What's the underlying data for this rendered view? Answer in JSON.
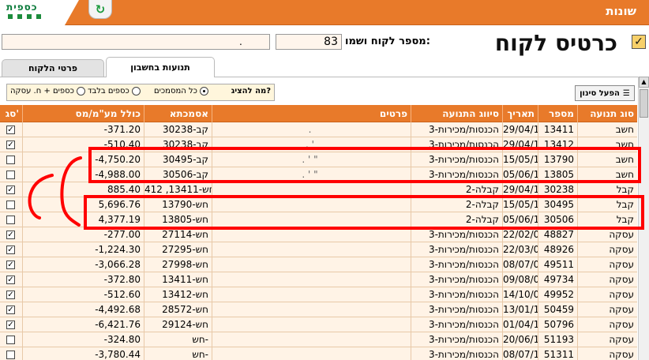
{
  "app": {
    "logo_text": "כספית",
    "title": "שונות"
  },
  "header": {
    "page_title": "כרטיס לקוח",
    "customer_label": "מספר לקוח ושמו:",
    "customer_number": "83",
    "customer_name": "."
  },
  "tabs": [
    {
      "label": "תנועות בחשבון",
      "active": true
    },
    {
      "label": "פרטי הלקוח",
      "active": false
    }
  ],
  "filter": {
    "question": "מה להציג?",
    "options": [
      {
        "label": "כל המסמכים",
        "selected": true
      },
      {
        "label": "כספים בלבד",
        "selected": false
      },
      {
        "label": "כספים + ח. עסקה",
        "selected": false
      }
    ],
    "button_label": "הפעל סינון"
  },
  "table": {
    "columns": [
      "סוג תנועה",
      "מספר",
      "תאריך",
      "סיווג התנועה",
      "פרטים",
      "אסמכתא",
      "כולל מע\"מ/מס",
      "סג'"
    ],
    "rows": [
      {
        "type": "חשב",
        "number": "13411",
        "date": "29/04/10",
        "category": "3-הכנסות/מכירות",
        "details": ".",
        "ref": "קב-30238",
        "amount": "-371.20",
        "checked": true
      },
      {
        "type": "חשב",
        "number": "13412",
        "date": "29/04/10",
        "category": "3-הכנסות/מכירות",
        "details": ". '",
        "ref": "קב-30238",
        "amount": "-510.40",
        "checked": true
      },
      {
        "type": "חשב",
        "number": "13790",
        "date": "15/05/11",
        "category": "3-הכנסות/מכירות",
        "details": ". ' \"",
        "ref": "קב-30495",
        "amount": "-4,750.20",
        "checked": false
      },
      {
        "type": "חשב",
        "number": "13805",
        "date": "05/06/11",
        "category": "3-הכנסות/מכירות",
        "details": ". ' \"",
        "ref": "קב-30506",
        "amount": "-4,988.00",
        "checked": false
      },
      {
        "type": "קבל",
        "number": "30238",
        "date": "29/04/10",
        "category": "2-קבלה",
        "details": "",
        "ref": "חש-13411, 412",
        "amount": "885.40",
        "checked": true
      },
      {
        "type": "קבל",
        "number": "30495",
        "date": "15/05/11",
        "category": "2-קבלה",
        "details": "",
        "ref": "חש-13790",
        "amount": "5,696.76",
        "checked": false
      },
      {
        "type": "קבל",
        "number": "30506",
        "date": "05/06/11",
        "category": "2-קבלה",
        "details": "",
        "ref": "חש-13805",
        "amount": "4,377.19",
        "checked": false
      },
      {
        "type": "עסקה",
        "number": "48827",
        "date": "22/02/09",
        "category": "3-הכנסות/מכירות",
        "details": "",
        "ref": "חש-27114",
        "amount": "-277.00",
        "checked": true
      },
      {
        "type": "עסקה",
        "number": "48926",
        "date": "22/03/09",
        "category": "3-הכנסות/מכירות",
        "details": "",
        "ref": "חש-27295",
        "amount": "-1,224.30",
        "checked": true
      },
      {
        "type": "עסקה",
        "number": "49511",
        "date": "08/07/09",
        "category": "3-הכנסות/מכירות",
        "details": "",
        "ref": "חש-27998",
        "amount": "-3,066.28",
        "checked": true
      },
      {
        "type": "עסקה",
        "number": "49734",
        "date": "09/08/09",
        "category": "3-הכנסות/מכירות",
        "details": "",
        "ref": "חש-13411",
        "amount": "-372.80",
        "checked": true
      },
      {
        "type": "עסקה",
        "number": "49952",
        "date": "14/10/09",
        "category": "3-הכנסות/מכירות",
        "details": "",
        "ref": "חש-13412",
        "amount": "-512.60",
        "checked": true
      },
      {
        "type": "עסקה",
        "number": "50459",
        "date": "13/01/10",
        "category": "3-הכנסות/מכירות",
        "details": "",
        "ref": "חש-28572",
        "amount": "-4,492.68",
        "checked": true
      },
      {
        "type": "עסקה",
        "number": "50796",
        "date": "01/04/10",
        "category": "3-הכנסות/מכירות",
        "details": "",
        "ref": "חש-29124",
        "amount": "-6,421.76",
        "checked": true
      },
      {
        "type": "עסקה",
        "number": "51193",
        "date": "20/06/10",
        "category": "3-הכנסות/מכירות",
        "details": "",
        "ref": "חש-",
        "amount": "-324.80",
        "checked": false
      },
      {
        "type": "עסקה",
        "number": "51311",
        "date": "08/07/10",
        "category": "3-הכנסות/מכירות",
        "details": "",
        "ref": "חש-",
        "amount": "-3,780.44",
        "checked": false
      }
    ]
  },
  "colors": {
    "accent": "#e87a2a",
    "row_bg": "#fff3e6",
    "annotation": "#ff0000"
  },
  "icons": {
    "refresh": "refresh-icon",
    "title_checkbox": "check-icon",
    "filter": "filter-list-icon"
  }
}
